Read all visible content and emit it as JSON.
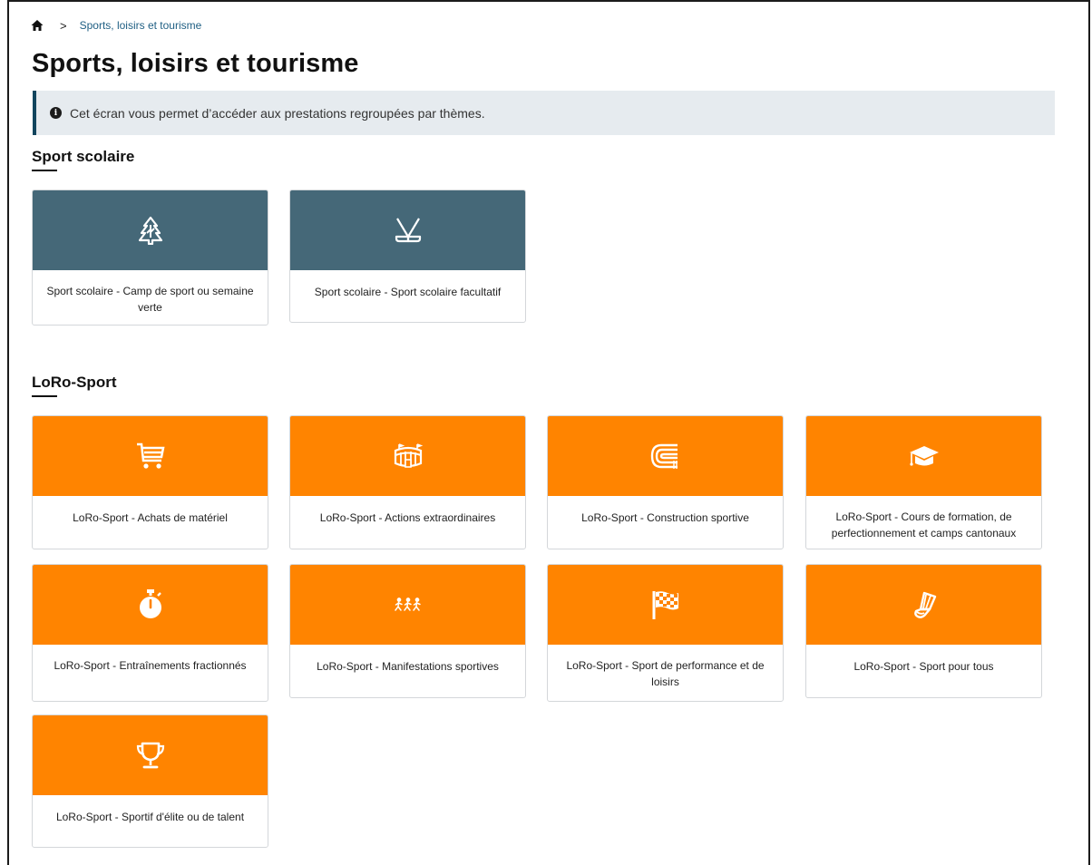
{
  "breadcrumb": {
    "home_icon": "home-icon",
    "separator": ">",
    "current": "Sports, loisirs et tourisme"
  },
  "page": {
    "title": "Sports, loisirs et tourisme"
  },
  "info": {
    "icon": "info-icon",
    "text": "Cet écran vous permet d’accéder aux prestations regroupées par thèmes."
  },
  "sections": [
    {
      "title": "Sport scolaire",
      "color": "#456878",
      "tiles": [
        {
          "label": "Sport scolaire - Camp de sport ou semaine verte",
          "icon": "tree-icon"
        },
        {
          "label": "Sport scolaire - Sport scolaire facultatif",
          "icon": "hockey-sticks-icon"
        }
      ]
    },
    {
      "title": "LoRo-Sport",
      "color": "#ff8400",
      "tiles": [
        {
          "label": "LoRo-Sport - Achats de matériel",
          "icon": "cart-icon"
        },
        {
          "label": "LoRo-Sport - Actions extraordinaires",
          "icon": "stadium-icon"
        },
        {
          "label": "LoRo-Sport - Construction sportive",
          "icon": "track-icon"
        },
        {
          "label": "LoRo-Sport - Cours de formation, de perfectionnement et camps cantonaux",
          "icon": "graduation-cap-icon"
        },
        {
          "label": "LoRo-Sport - Entraînements fractionnés",
          "icon": "stopwatch-icon"
        },
        {
          "label": "LoRo-Sport - Manifestations sportives",
          "icon": "runners-icon"
        },
        {
          "label": "LoRo-Sport - Sport de performance et de loisirs",
          "icon": "checkered-flag-icon"
        },
        {
          "label": "LoRo-Sport - Sport pour tous",
          "icon": "shuttlecock-icon"
        },
        {
          "label": "LoRo-Sport - Sportif d'élite ou de talent",
          "icon": "trophy-icon"
        }
      ]
    }
  ]
}
